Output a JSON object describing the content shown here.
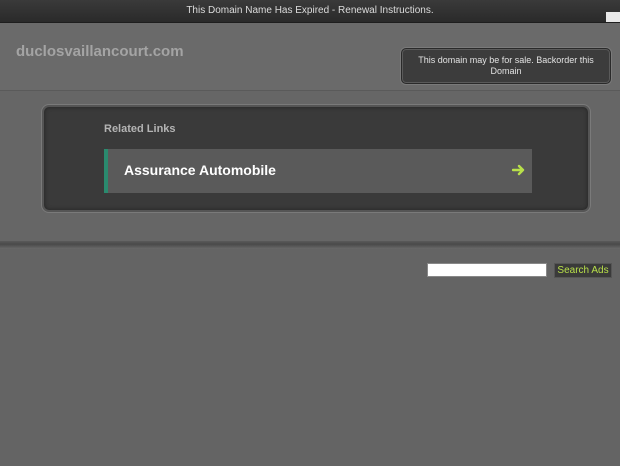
{
  "topbar": {
    "expired_notice": "This Domain Name Has Expired - Renewal Instructions."
  },
  "header": {
    "site_title": "duclosvaillancourt.com",
    "sale_notice": "This domain may be for sale. Backorder this Domain"
  },
  "related_links": {
    "heading": "Related Links",
    "items": [
      {
        "label": "Assurance Automobile",
        "icon": "arrow-right-icon"
      }
    ]
  },
  "search": {
    "input_value": "",
    "button_label": "Search Ads"
  },
  "colors": {
    "background": "#646464",
    "accent_bar": "#2a8a6e",
    "arrow": "#b8e04a"
  }
}
